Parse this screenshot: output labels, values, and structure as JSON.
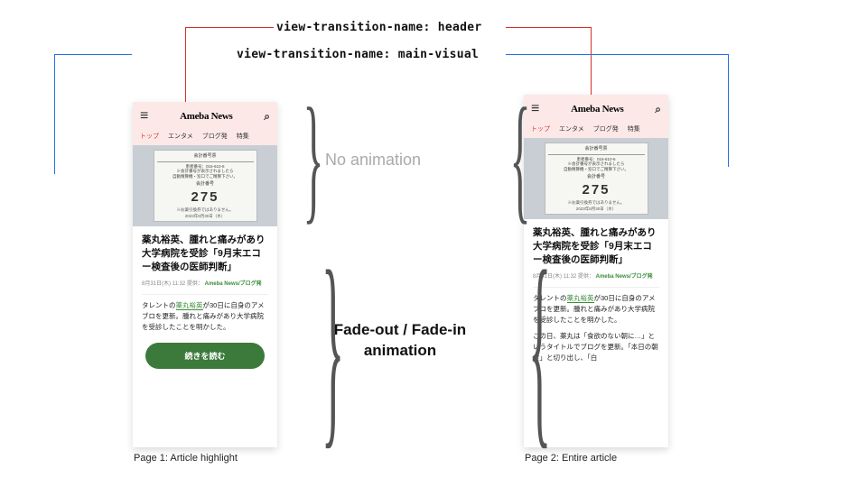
{
  "labels": {
    "header_css": "view-transition-name: header",
    "main_css": "view-transition-name: main-visual"
  },
  "annotations": {
    "no_anim": "No animation",
    "fade_line1": "Fade-out / Fade-in",
    "fade_line2": "animation"
  },
  "captions": {
    "page1": "Page 1: Article highlight",
    "page2": "Page 2: Entire article"
  },
  "site": {
    "logo": "Ameba News",
    "tabs": [
      "トップ",
      "エンタメ",
      "ブログ発",
      "特集"
    ]
  },
  "ticket": {
    "title": "会計番号票",
    "line2a": "患者番号：016-610-6",
    "line2b": "※会計番号が表示されましたら",
    "line2c": "自動精算機・窓口でご精算下さい。",
    "label": "会計番号",
    "number": "275",
    "note": "※お薬引換券ではありません。",
    "date": "2023年8月30日（水）"
  },
  "article": {
    "headline": "薬丸裕英、腫れと痛みがあり大学病院を受診「9月末エコー検査後の医師判断」",
    "meta_time": "8月31日(木) 11:32",
    "meta_provider": "提供：",
    "meta_source": "Ameba News/ブログ発",
    "body_p1_a": "タレントの",
    "body_p1_link": "薬丸裕英",
    "body_p1_b": "が30日に自身のアメブロを更新。腫れと痛みがあり大学病院を受診したことを明かした。",
    "body_p2": "この日、薬丸は「食欲のない朝に…」というタイトルでブログを更新。「本日の朝食」と切り出し、「白",
    "cta": "続きを読む"
  }
}
